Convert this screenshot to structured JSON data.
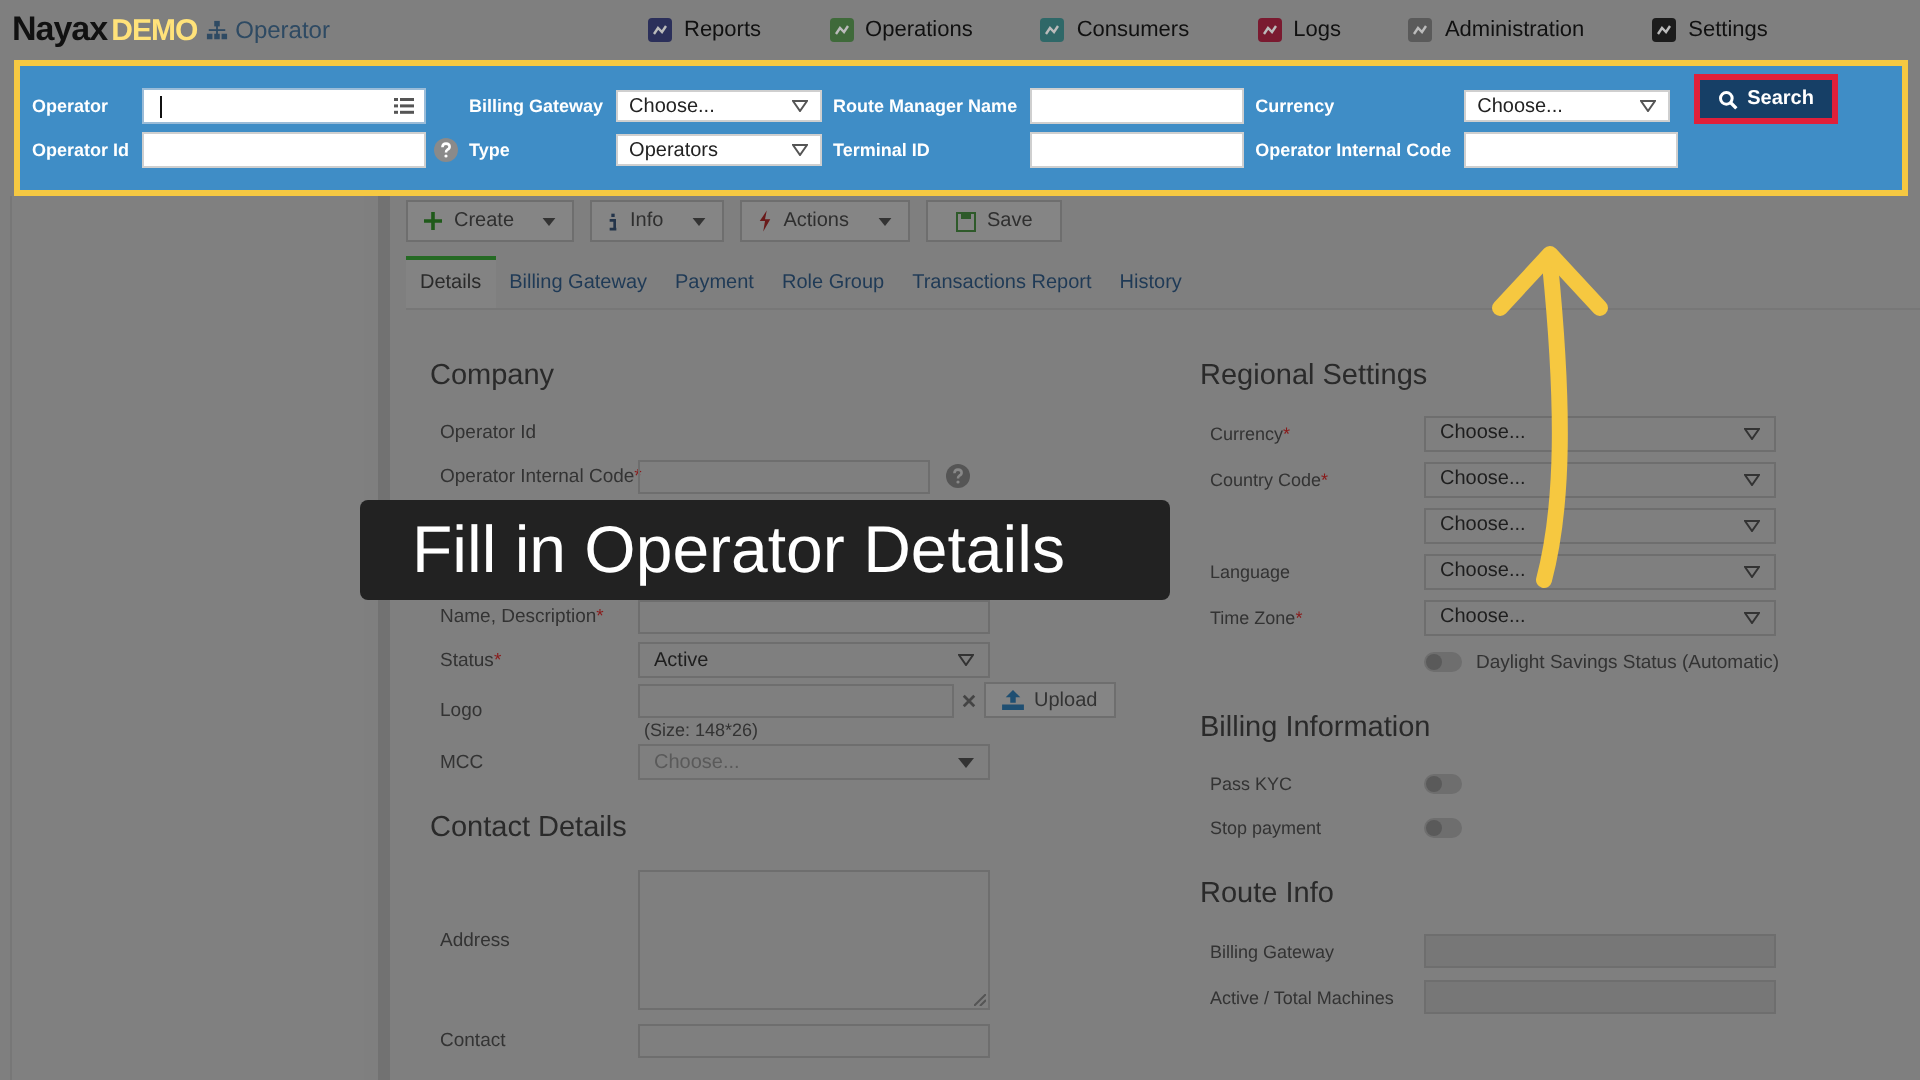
{
  "header": {
    "brand": "Nayax",
    "brand_accent": "DEMO",
    "section": "Operator"
  },
  "nav": [
    {
      "label": "Reports"
    },
    {
      "label": "Operations"
    },
    {
      "label": "Consumers"
    },
    {
      "label": "Logs"
    },
    {
      "label": "Administration"
    },
    {
      "label": "Settings"
    }
  ],
  "search": {
    "fields": [
      {
        "kind": "picker",
        "label": "Operator",
        "focused": true
      },
      {
        "kind": "select",
        "label": "Billing Gateway",
        "value": "Choose..."
      },
      {
        "kind": "text",
        "label": "Route Manager Name",
        "focused": false
      },
      {
        "kind": "select",
        "label": "Currency",
        "value": "Choose..."
      },
      {
        "kind": "help",
        "label": "Operator Id",
        "focused": false
      },
      {
        "kind": "select",
        "label": "Type",
        "value": "Operators"
      },
      {
        "kind": "text",
        "label": "Terminal ID",
        "focused": false
      },
      {
        "kind": "text",
        "label": "Operator Internal Code",
        "focused": false
      }
    ],
    "button": "Search"
  },
  "toolbar": [
    {
      "kind": "create",
      "label": "Create"
    },
    {
      "kind": "info",
      "label": "Info"
    },
    {
      "kind": "actions",
      "label": "Actions"
    },
    {
      "kind": "save",
      "label": "Save"
    }
  ],
  "tabs": [
    {
      "label": "Details",
      "selected": true
    },
    {
      "label": "Billing Gateway",
      "selected": false
    },
    {
      "label": "Payment",
      "selected": false
    },
    {
      "label": "Role Group",
      "selected": false
    },
    {
      "label": "Transactions Report",
      "selected": false
    },
    {
      "label": "History",
      "selected": false
    }
  ],
  "left": [
    {
      "title": "Company",
      "rows": [
        {
          "kind": "static",
          "label": "Operator Id"
        },
        {
          "kind": "help",
          "label": "Operator Internal Code",
          "required": "*"
        },
        {
          "kind": "text",
          "label": "Name, Description",
          "required": "*"
        },
        {
          "kind": "select",
          "label": "Status",
          "required": "*",
          "value": "Active"
        },
        {
          "kind": "upload",
          "label": "Logo",
          "button": "Upload",
          "hint": "(Size: 148*26)"
        },
        {
          "kind": "select",
          "label": "MCC",
          "placeholder": "Choose..."
        }
      ]
    },
    {
      "title": "Contact Details",
      "rows": [
        {
          "kind": "textarea",
          "label": "Address"
        },
        {
          "kind": "text",
          "label": "Contact"
        }
      ]
    }
  ],
  "right": [
    {
      "title": "Regional Settings",
      "rows": [
        {
          "kind": "select",
          "label": "Currency",
          "required": "*",
          "value": "Choose..."
        },
        {
          "kind": "select",
          "label": "Country Code",
          "required": "*",
          "value": "Choose..."
        },
        {
          "kind": "select",
          "value": "Choose..."
        },
        {
          "kind": "select",
          "label": "Language",
          "value": "Choose..."
        },
        {
          "kind": "select",
          "label": "Time Zone",
          "required": "*",
          "value": "Choose..."
        },
        {
          "kind": "toggle",
          "text": "Daylight Savings Status (Automatic)",
          "on": false
        }
      ]
    },
    {
      "title": "Billing Information",
      "rows": [
        {
          "kind": "toggle",
          "label": "Pass KYC",
          "on": false
        },
        {
          "kind": "toggle",
          "label": "Stop payment",
          "on": false
        }
      ]
    },
    {
      "title": "Route Info",
      "rows": [
        {
          "kind": "readonly",
          "label": "Billing Gateway"
        },
        {
          "kind": "readonly",
          "label": "Active / Total Machines"
        }
      ]
    }
  ],
  "banner": {
    "text": "Fill in Operator Details"
  }
}
